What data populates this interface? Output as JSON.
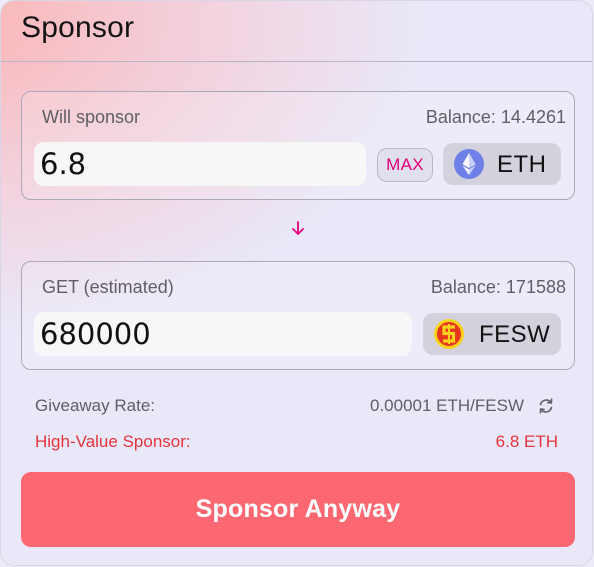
{
  "header": {
    "title": "Sponsor"
  },
  "sponsor_panel": {
    "label": "Will sponsor",
    "balance": "Balance: 14.4261",
    "amount_value": "6.8",
    "max_label": "MAX",
    "token": {
      "symbol": "ETH",
      "icon": "ethereum-icon"
    }
  },
  "switch": {
    "icon": "arrow-down-icon"
  },
  "get_panel": {
    "label": "GET (estimated)",
    "balance": "Balance: 171588",
    "amount_value": "680000",
    "token": {
      "symbol": "FESW",
      "icon": "fesw-icon"
    }
  },
  "giveaway_rate": {
    "label": "Giveaway Rate:",
    "value": "0.00001 ETH/FESW",
    "icon": "refresh-icon"
  },
  "warning": {
    "label": "High-Value Sponsor:",
    "value": "6.8 ETH"
  },
  "action": {
    "label": "Sponsor Anyway"
  },
  "colors": {
    "accent_pink": "#e6007a",
    "warning_red": "#e8323c",
    "button_red": "#fc6872"
  }
}
